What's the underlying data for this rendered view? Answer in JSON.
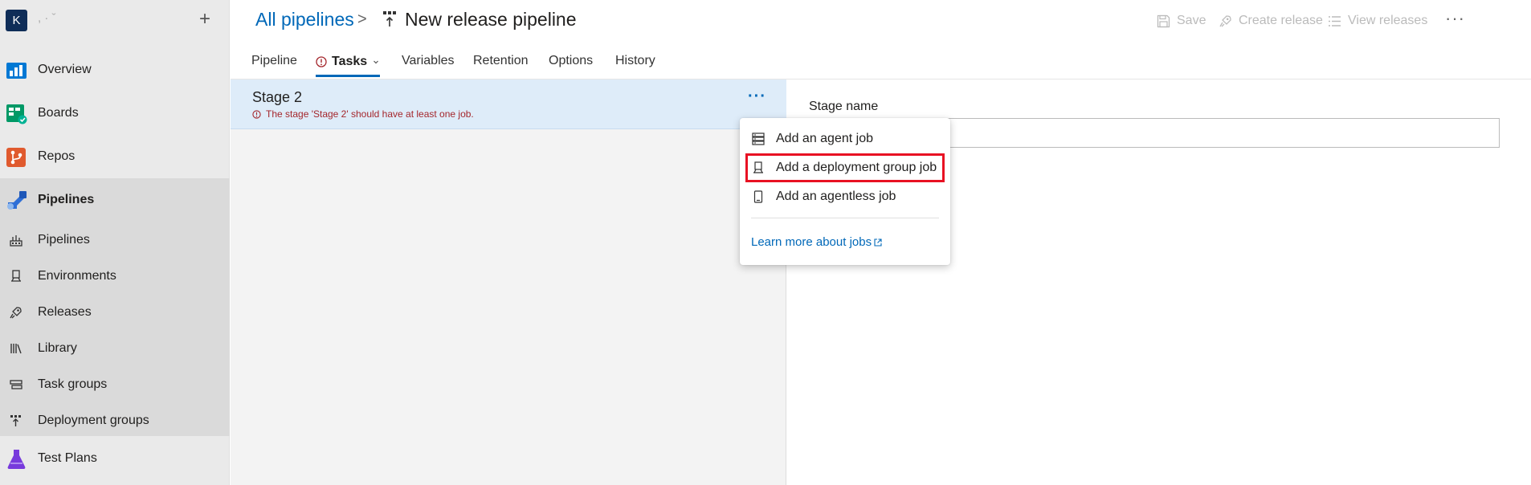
{
  "org": {
    "initial": "K",
    "name": ", · ˇ",
    "add_glyph": "+"
  },
  "nav": {
    "main": [
      {
        "label": "Overview",
        "icon": "overview-icon",
        "color": "#0078d4"
      },
      {
        "label": "Boards",
        "icon": "boards-icon",
        "color": "#009966"
      },
      {
        "label": "Repos",
        "icon": "repos-icon",
        "color": "#e05a2e"
      },
      {
        "label": "Pipelines",
        "icon": "pipelines-icon",
        "color": "#2f6fd6"
      }
    ],
    "sub": [
      {
        "label": "Pipelines",
        "icon": "pipelines-sub-icon"
      },
      {
        "label": "Environments",
        "icon": "environments-icon"
      },
      {
        "label": "Releases",
        "icon": "releases-icon"
      },
      {
        "label": "Library",
        "icon": "library-icon"
      },
      {
        "label": "Task groups",
        "icon": "task-groups-icon"
      },
      {
        "label": "Deployment groups",
        "icon": "deployment-groups-icon"
      }
    ],
    "test_plans": {
      "label": "Test Plans",
      "icon": "test-plans-icon",
      "color": "#773adc"
    }
  },
  "header": {
    "breadcrumb_root": "All pipelines",
    "breadcrumb_sep": ">",
    "title": "New release pipeline",
    "toolbar": {
      "save": "Save",
      "create_release": "Create release",
      "view_releases": "View releases",
      "more": "···"
    }
  },
  "tabs": {
    "pipeline": "Pipeline",
    "tasks": "Tasks",
    "variables": "Variables",
    "retention": "Retention",
    "options": "Options",
    "history": "History"
  },
  "stage": {
    "name": "Stage 2",
    "warning": "The stage 'Stage 2' should have at least one job.",
    "more": "···"
  },
  "properties": {
    "stage_name_label": "Stage name",
    "stage_name_value": ""
  },
  "menu": {
    "items": [
      {
        "label": "Add an agent job",
        "icon": "agent-job-icon"
      },
      {
        "label": "Add a deployment group job",
        "icon": "deployment-group-job-icon"
      },
      {
        "label": "Add an agentless job",
        "icon": "agentless-job-icon"
      }
    ],
    "learn_more": "Learn more about jobs"
  },
  "colors": {
    "accent": "#0068b8",
    "error": "#a4262c",
    "highlight_box": "#e81123",
    "stage_selected_bg": "#deecf9"
  }
}
